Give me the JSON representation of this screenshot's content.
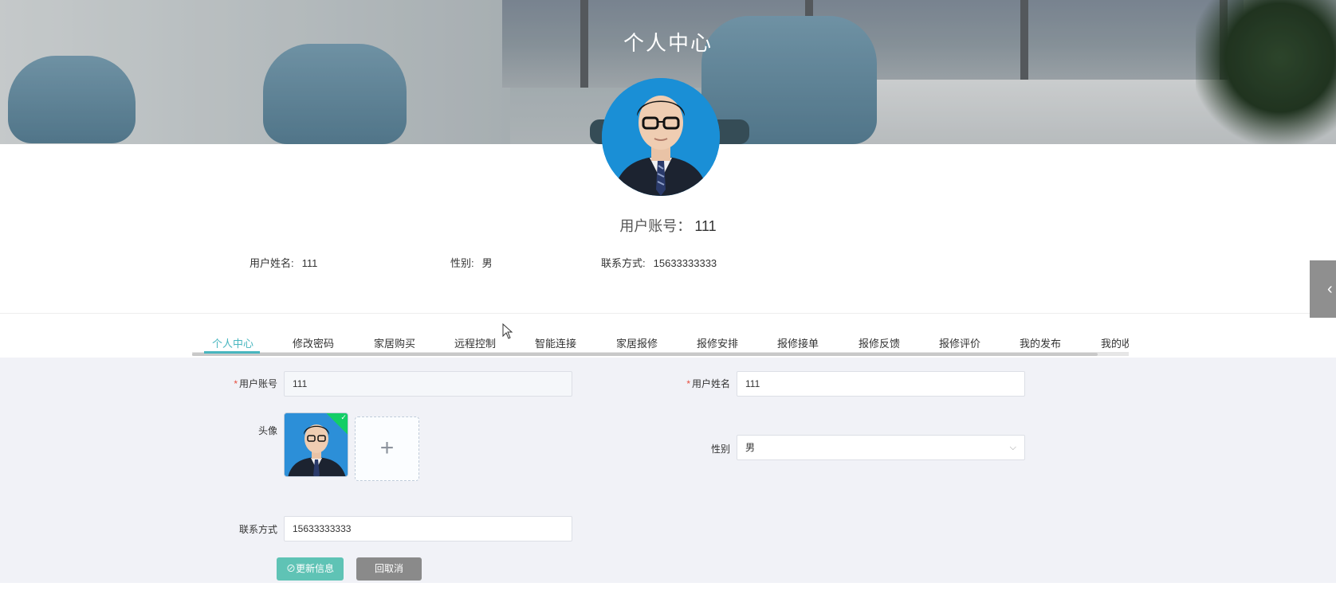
{
  "header": {
    "title": "个人中心"
  },
  "profile": {
    "account_label": "用户账号：",
    "account_value": "111",
    "name_label": "用户姓名:",
    "name_value": "111",
    "gender_label": "性别:",
    "gender_value": "男",
    "contact_label": "联系方式:",
    "contact_value": "15633333333"
  },
  "tabs": [
    {
      "label": "个人中心",
      "active": true
    },
    {
      "label": "修改密码"
    },
    {
      "label": "家居购买"
    },
    {
      "label": "远程控制"
    },
    {
      "label": "智能连接"
    },
    {
      "label": "家居报修"
    },
    {
      "label": "报修安排"
    },
    {
      "label": "报修接单"
    },
    {
      "label": "报修反馈"
    },
    {
      "label": "报修评价"
    },
    {
      "label": "我的发布"
    },
    {
      "label": "我的收藏"
    }
  ],
  "form": {
    "account": {
      "required_mark": "*",
      "label": "用户账号",
      "value": "111"
    },
    "name": {
      "required_mark": "*",
      "label": "用户姓名",
      "value": "111"
    },
    "avatar": {
      "label": "头像",
      "add_symbol": "+",
      "success_mark": "✓"
    },
    "gender": {
      "label": "性别",
      "value": "男",
      "arrow": "⌵"
    },
    "contact": {
      "label": "联系方式",
      "value": "15633333333"
    },
    "update_button": "⊘更新信息",
    "cancel_button": "回取消"
  },
  "side_handle": {
    "icon": "‹"
  },
  "colors": {
    "accent": "#48b6bf",
    "update_button": "#5fc3b5",
    "cancel_button": "#8a8a8a",
    "form_background": "#f1f2f7",
    "required": "#e74c3c"
  }
}
